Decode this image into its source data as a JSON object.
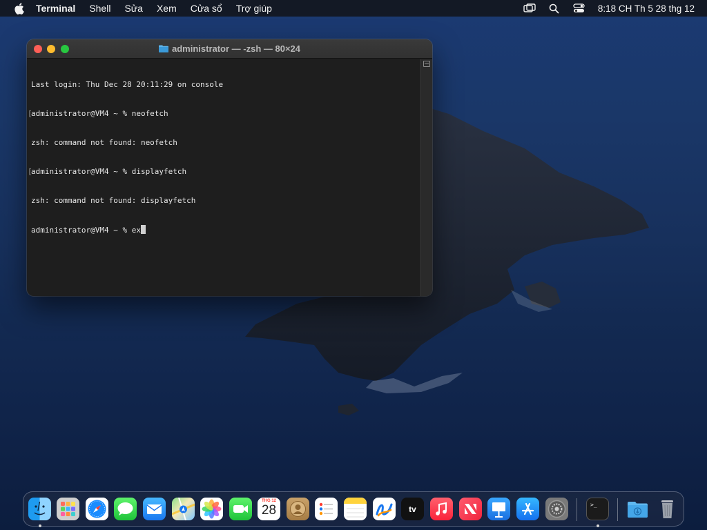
{
  "menubar": {
    "app_name": "Terminal",
    "items": [
      "Shell",
      "Sửa",
      "Xem",
      "Cửa sổ",
      "Trợ giúp"
    ],
    "clock": "8:18 CH Th 5 28 thg 12"
  },
  "window": {
    "title": "administrator — -zsh — 80×24",
    "lines": [
      "Last login: Thu Dec 28 20:11:29 on console",
      "administrator@VM4 ~ % neofetch",
      "zsh: command not found: neofetch",
      "administrator@VM4 ~ % displayfetch",
      "zsh: command not found: displayfetch",
      "administrator@VM4 ~ % ex"
    ]
  },
  "dock": {
    "calendar_month": "THG 12",
    "calendar_day": "28",
    "tv_label": "tv",
    "terminal_prompt": ">_"
  },
  "colors": {
    "close": "#fe5f57",
    "minimize": "#febc2e",
    "maximize": "#28c840",
    "terminal_bg": "#1e1e1e"
  }
}
